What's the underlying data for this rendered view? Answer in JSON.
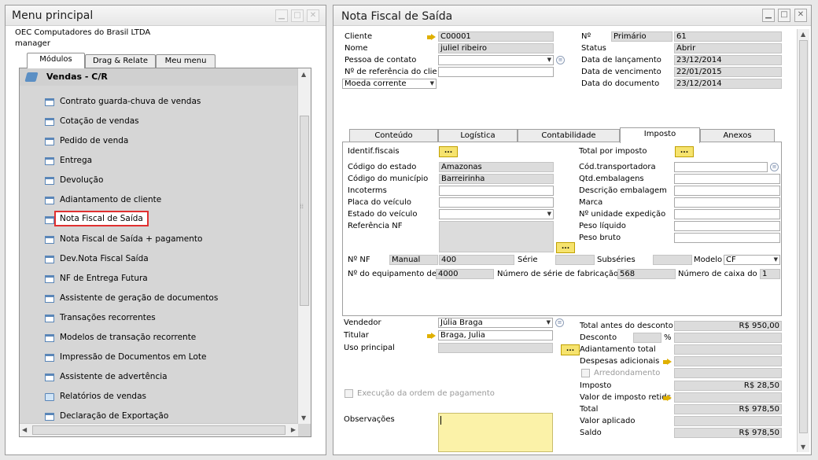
{
  "menu": {
    "title": "Menu principal",
    "company": "OEC Computadores do Brasil LTDA",
    "user": "manager",
    "tabs": [
      "Módulos",
      "Drag & Relate",
      "Meu menu"
    ],
    "module_header": "Vendas - C/R",
    "items": [
      "Contrato guarda-chuva de vendas",
      "Cotação de vendas",
      "Pedido de venda",
      "Entrega",
      "Devolução",
      "Adiantamento de cliente",
      "Nota Fiscal de Saída",
      "Nota Fiscal de Saída + pagamento",
      "Dev.Nota Fiscal Saída",
      "NF de Entrega Futura",
      "Assistente de geração de documentos",
      "Transações recorrentes",
      "Modelos de transação recorrente",
      "Impressão de Documentos em Lote",
      "Assistente de advertência",
      "Relatórios de vendas",
      "Declaração de Exportação"
    ],
    "selected_item": "Nota Fiscal de Saída"
  },
  "nf": {
    "title": "Nota Fiscal de Saída",
    "header_left": {
      "cliente_label": "Cliente",
      "cliente": "C00001",
      "nome_label": "Nome",
      "nome": "juliel ribeiro",
      "pessoa_label": "Pessoa de contato",
      "pessoa": "",
      "ref_label": "Nº de referência do clie",
      "ref": "",
      "moeda": "Moeda corrente"
    },
    "header_right": {
      "no_label": "Nº",
      "serie_tipo": "Primário",
      "no": "61",
      "status_label": "Status",
      "status": "Abrir",
      "lanc_label": "Data de lançamento",
      "lanc": "23/12/2014",
      "venc_label": "Data de vencimento",
      "venc": "22/01/2015",
      "doc_label": "Data do documento",
      "doc": "23/12/2014"
    },
    "tabs": [
      "Conteúdo",
      "Logística",
      "Contabilidade",
      "Imposto",
      "Anexos"
    ],
    "active_tab": "Imposto",
    "imposto": {
      "identif": "Identif.fiscais",
      "estado_label": "Código do estado",
      "estado": "Amazonas",
      "municipio_label": "Código do município",
      "municipio": "Barreirinha",
      "incoterms": "Incoterms",
      "placa": "Placa do veículo",
      "estado_veiculo": "Estado do veículo",
      "ref_nf": "Referência NF",
      "total_imposto": "Total por imposto",
      "transportadora": "Cód.transportadora",
      "qtd_emb": "Qtd.embalagens",
      "desc_emb": "Descrição embalagem",
      "marca": "Marca",
      "unidade_exp": "Nº unidade expedição",
      "peso_liq": "Peso líquido",
      "peso_bruto": "Peso bruto",
      "no_nf_label": "Nº NF",
      "no_nf_tipo": "Manual",
      "no_nf": "400",
      "serie_label": "Série",
      "subseries_label": "Subséries",
      "modelo_label": "Modelo",
      "modelo": "CF",
      "equip_label": "Nº do equipamento de pc",
      "equip": "4000",
      "fab_label": "Número de série de fabricação do",
      "fab": "568",
      "caixa_label": "Número de caixa do pc",
      "caixa": "1"
    },
    "footer_left": {
      "vendedor_label": "Vendedor",
      "vendedor": "Júlia Braga",
      "titular_label": "Titular",
      "titular": "Braga, Julia",
      "uso_label": "Uso principal",
      "execucao": "Execução da ordem de pagamento",
      "obs_label": "Observações"
    },
    "totals": {
      "antes_label": "Total antes do desconto",
      "antes": "R$ 950,00",
      "desconto_label": "Desconto",
      "pct": "%",
      "adiant_label": "Adiantamento total",
      "despesas_label": "Despesas adicionais",
      "arred_label": "Arredondamento",
      "imposto_label": "Imposto",
      "imposto": "R$ 28,50",
      "retido_label": "Valor de imposto retidc",
      "total_label": "Total",
      "total": "R$ 978,50",
      "aplicado_label": "Valor aplicado",
      "saldo_label": "Saldo",
      "saldo": "R$ 978,50"
    },
    "dots_label": "..."
  }
}
